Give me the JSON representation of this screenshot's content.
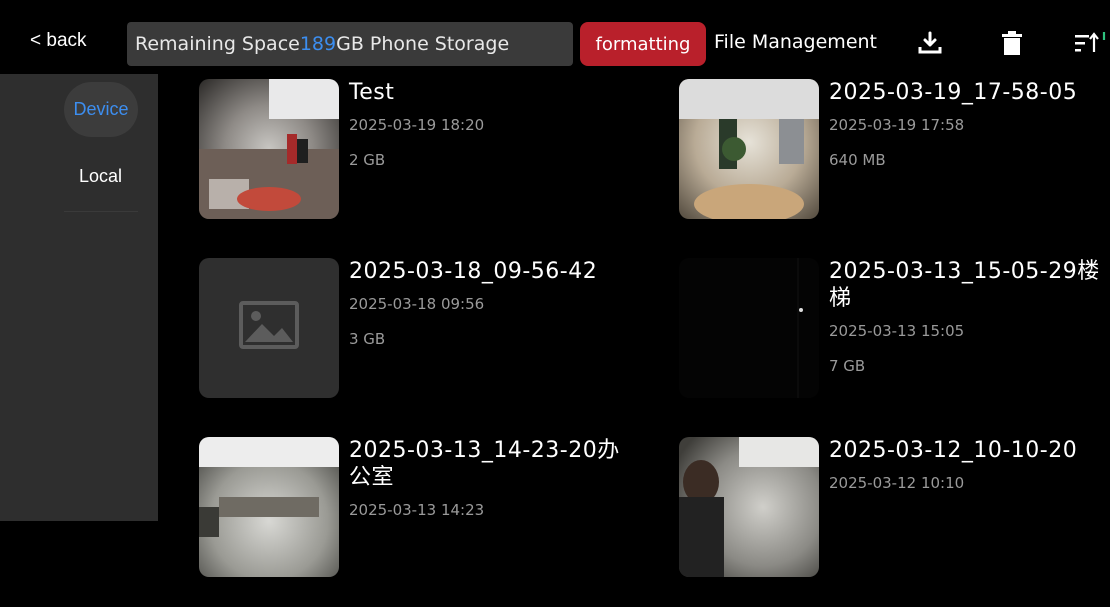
{
  "topbar": {
    "back_label": "< back",
    "storage_prefix": "Remaining Space",
    "storage_value": "189",
    "storage_suffix": "GB Phone Storage",
    "format_label": "formatting",
    "file_mgmt_label": "File Management",
    "icons": [
      "download-icon",
      "trash-icon",
      "sort-icon"
    ]
  },
  "sidebar": {
    "tabs": [
      {
        "label": "Device",
        "selected": true
      },
      {
        "label": "Local",
        "selected": false
      }
    ]
  },
  "files": [
    {
      "name": "Test",
      "datetime": "2025-03-19 18:20",
      "size": "2 GB",
      "thumb": "panorama-office"
    },
    {
      "name": "2025-03-19_17-58-05",
      "datetime": "2025-03-19 17:58",
      "size": "640 MB",
      "thumb": "panorama-hall"
    },
    {
      "name": "2025-03-18_09-56-42",
      "datetime": "2025-03-18 09:56",
      "size": "3 GB",
      "thumb": "placeholder-image"
    },
    {
      "name": "2025-03-13_15-05-29楼梯",
      "datetime": "2025-03-13 15:05",
      "size": "7 GB",
      "thumb": "dark-frame"
    },
    {
      "name": "2025-03-13_14-23-20办公室",
      "datetime": "2025-03-13 14:23",
      "size": "",
      "thumb": "panorama-office-wide"
    },
    {
      "name": "2025-03-12_10-10-20",
      "datetime": "2025-03-12 10:10",
      "size": "",
      "thumb": "panorama-person"
    }
  ],
  "colors": {
    "accent_blue": "#3c8ef0",
    "format_red": "#b9202b",
    "sidebar_bg": "#2e2e2e",
    "storage_bg": "#3a3a3a"
  }
}
